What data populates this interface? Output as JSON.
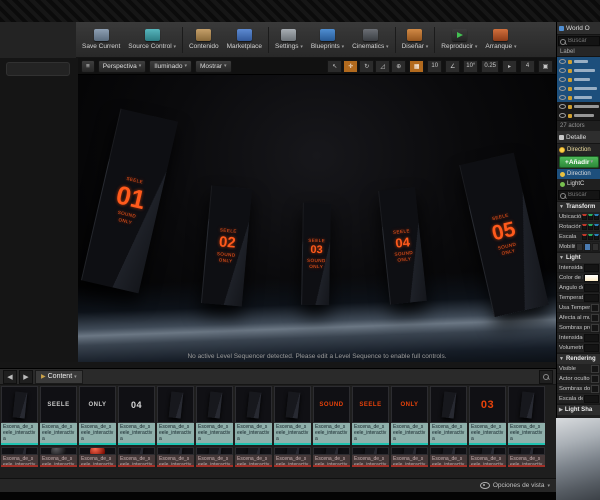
{
  "accent_colors": {
    "monolith_text": "#ff5a1c",
    "selection_blue": "#1d4f7c",
    "add_green": "#3fae49",
    "asset_teal": "#1fc2b0"
  },
  "toolbar": {
    "buttons": [
      {
        "label": "Save Current",
        "icon": "save-icon",
        "cls": "ic-save",
        "arrow": false
      },
      {
        "label": "Source Control",
        "icon": "source-control-icon",
        "cls": "ic-source",
        "arrow": true
      },
      {
        "label": "Contenido",
        "icon": "content-browser-icon",
        "cls": "ic-content",
        "arrow": false
      },
      {
        "label": "Marketplace",
        "icon": "marketplace-icon",
        "cls": "ic-market",
        "arrow": false
      },
      {
        "label": "Settings",
        "icon": "settings-gear-icon",
        "cls": "ic-settings",
        "arrow": true
      },
      {
        "label": "Blueprints",
        "icon": "blueprints-icon",
        "cls": "ic-blueprints",
        "arrow": true
      },
      {
        "label": "Cinematics",
        "icon": "cinematics-icon",
        "cls": "ic-cinematics",
        "arrow": true
      },
      {
        "label": "Diseñar",
        "icon": "build-icon",
        "cls": "ic-build",
        "arrow": true
      },
      {
        "label": "Reproducir",
        "icon": "play-icon",
        "cls": "ic-play",
        "arrow": true
      },
      {
        "label": "Arranque",
        "icon": "launch-icon",
        "cls": "ic-launch",
        "arrow": true
      }
    ],
    "separators_after": [
      1,
      3,
      6,
      7
    ]
  },
  "viewport": {
    "menu_glyph": "≡",
    "perspective": "Perspectiva",
    "lit": "Iluminado",
    "show": "Mostrar",
    "dropdown_glyph": "▾",
    "tools": [
      {
        "name": "select-tool-icon",
        "glyph": "↖",
        "active": false
      },
      {
        "name": "move-tool-icon",
        "glyph": "✛",
        "active": true
      },
      {
        "name": "rotate-tool-icon",
        "glyph": "↻",
        "active": false
      },
      {
        "name": "scale-tool-icon",
        "glyph": "◿",
        "active": false
      },
      {
        "name": "world-space-icon",
        "glyph": "⊕",
        "active": false
      }
    ],
    "snap": {
      "grid_glyph": "▦",
      "grid": "10",
      "angle_glyph": "∠",
      "angle": "10°",
      "scale_glyph": "▫",
      "scale": "0.25",
      "camera_glyph": "▸",
      "camera_speed": "4",
      "maximize_glyph": "▣"
    },
    "message": "No active Level Sequencer detected. Please edit a Level Sequence to enable full controls.",
    "monoliths": [
      {
        "top": "SEELE",
        "num": "01",
        "sub": "SOUND\nONLY"
      },
      {
        "top": "SEELE",
        "num": "02",
        "sub": "SOUND\nONLY"
      },
      {
        "top": "SEELE",
        "num": "03",
        "sub": "SOUND\nONLY"
      },
      {
        "top": "SEELE",
        "num": "04",
        "sub": "SOUND\nONLY"
      },
      {
        "top": "SEELE",
        "num": "05",
        "sub": "SOUND\nONLY"
      }
    ]
  },
  "outliner": {
    "tab": "World O",
    "search_placeholder": "Buscar",
    "header": "Label",
    "rows": [
      {
        "sel": true
      },
      {
        "sel": true
      },
      {
        "sel": true
      },
      {
        "sel": true
      },
      {
        "sel": true
      },
      {
        "sel": false
      },
      {
        "sel": false
      }
    ],
    "count": "27 actors"
  },
  "details": {
    "tab": "Detalle",
    "actor_name": "Direction",
    "add_button": "+Añadir",
    "add_arrow": "▾",
    "components": [
      {
        "label": "Direction",
        "selected": true,
        "icon": "directional-light-icon",
        "ico_cls": ""
      },
      {
        "label": "LightC",
        "selected": false,
        "icon": "light-component-icon",
        "ico_cls": "g"
      }
    ],
    "search_placeholder": "Buscar",
    "sections": [
      {
        "title": "Transform",
        "collapsed": false,
        "rows": [
          {
            "label": "Ubicación",
            "control": "vec3"
          },
          {
            "label": "Rotación",
            "control": "vec3"
          },
          {
            "label": "Escala",
            "control": "vec3"
          },
          {
            "label": "Mobility",
            "control": "segmented"
          }
        ]
      },
      {
        "title": "Light",
        "collapsed": false,
        "rows": [
          {
            "label": "Intensidad",
            "control": "num"
          },
          {
            "label": "Color de la luz",
            "control": "color"
          },
          {
            "label": "Ángulo de la f",
            "control": "num"
          },
          {
            "label": "Temperatura",
            "control": "num"
          },
          {
            "label": "Usa Temperat",
            "control": "check"
          },
          {
            "label": "Afecta al mun",
            "control": "check"
          },
          {
            "label": "Sombras proy",
            "control": "check"
          },
          {
            "label": "Intensidad ind",
            "control": "num"
          },
          {
            "label": "Volumetric Sc",
            "control": "num"
          }
        ]
      },
      {
        "title": "Rendering",
        "collapsed": false,
        "rows": [
          {
            "label": "Visible",
            "control": "check"
          },
          {
            "label": "Actor oculto e",
            "control": "check"
          },
          {
            "label": "Sombras dobl",
            "control": "check"
          },
          {
            "label": "Escala del lím",
            "control": "num"
          }
        ]
      },
      {
        "title": "Light Sha",
        "collapsed": true,
        "rows": []
      }
    ]
  },
  "content": {
    "nav_back": "◀",
    "nav_forward": "▶",
    "tab": "Content",
    "tab_arrow": "▾",
    "asset_name": "Escena_de_seele_interactiva",
    "items": [
      {
        "thumb": "slab"
      },
      {
        "thumb": "word",
        "text": "SEELE",
        "color": "#c8c8c8",
        "size": 6
      },
      {
        "thumb": "word",
        "text": "ONLY",
        "color": "#c8c8c8",
        "size": 6
      },
      {
        "thumb": "word",
        "text": "04",
        "color": "#d8d8d8",
        "size": 9
      },
      {
        "thumb": "slab"
      },
      {
        "thumb": "slab"
      },
      {
        "thumb": "slab"
      },
      {
        "thumb": "slab"
      },
      {
        "thumb": "word",
        "text": "SOUND",
        "color": "#e8420a",
        "size": 6
      },
      {
        "thumb": "word",
        "text": "SEELE",
        "color": "#e8420a",
        "size": 6
      },
      {
        "thumb": "word",
        "text": "ONLY",
        "color": "#e8420a",
        "size": 6
      },
      {
        "thumb": "slab"
      },
      {
        "thumb": "word",
        "text": "03",
        "color": "#e8420a",
        "size": 11
      },
      {
        "thumb": "slab"
      }
    ],
    "items2": [
      {
        "thumb": "slab"
      },
      {
        "thumb": "sphere-dark"
      },
      {
        "thumb": "sphere-red"
      },
      {
        "thumb": "slab"
      },
      {
        "thumb": "slab"
      },
      {
        "thumb": "slab"
      },
      {
        "thumb": "slab"
      },
      {
        "thumb": "slab"
      },
      {
        "thumb": "slab"
      },
      {
        "thumb": "slab"
      },
      {
        "thumb": "slab"
      },
      {
        "thumb": "slab"
      },
      {
        "thumb": "slab"
      },
      {
        "thumb": "slab"
      }
    ],
    "view_options": "Opciones de vista",
    "view_options_arrow": "▾"
  }
}
